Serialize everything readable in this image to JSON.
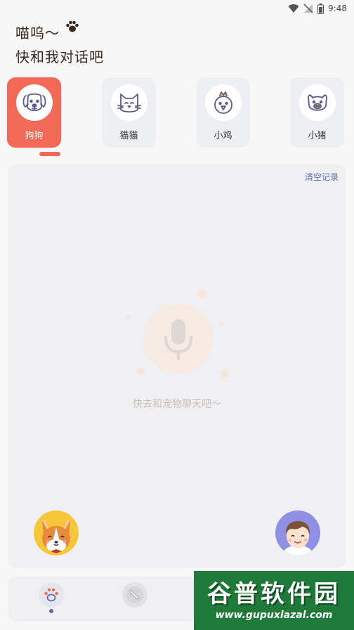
{
  "status_bar": {
    "time": "9:48"
  },
  "header": {
    "line1": "喵呜～",
    "line2": "快和我对话吧"
  },
  "pet_tabs": [
    {
      "label": "狗狗",
      "icon": "dog-icon",
      "active": true
    },
    {
      "label": "猫猫",
      "icon": "cat-icon",
      "active": false
    },
    {
      "label": "小鸡",
      "icon": "chick-icon",
      "active": false
    },
    {
      "label": "小猪",
      "icon": "pig-icon",
      "active": false
    }
  ],
  "chat": {
    "clear_label": "清空记录",
    "empty_text": "快去和宠物聊天吧～"
  },
  "nav": {
    "items": [
      {
        "icon": "paw-icon",
        "active": true
      },
      {
        "icon": "bone-icon",
        "active": false
      }
    ]
  },
  "watermark": {
    "title": "谷普软件园",
    "url": "www.gupuxlazal.com"
  },
  "colors": {
    "accent": "#f26a55",
    "link": "#5b6ab0",
    "pet_avatar_bg": "#f7c73b",
    "user_avatar_bg": "#8f8fe6"
  }
}
